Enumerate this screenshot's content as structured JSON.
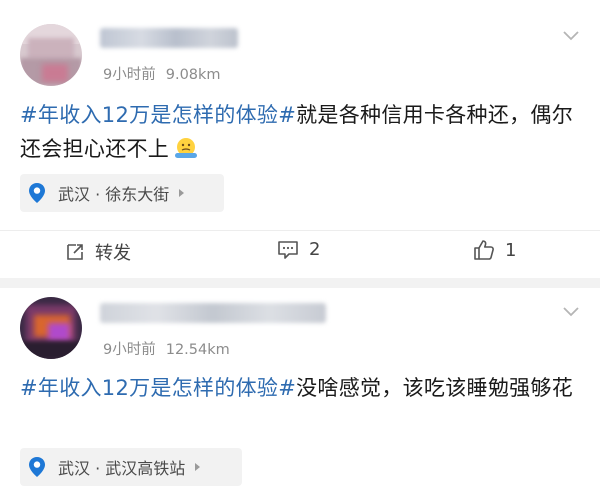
{
  "posts": [
    {
      "time": "9小时前",
      "distance": "9.08km",
      "topic": "#年收入12万是怎样的体验#",
      "text": "就是各种信用卡各种还，偶尔还会担心还不上",
      "location": "武汉 · 徐东大街",
      "actions": {
        "repost_label": "转发",
        "comment_count": "2",
        "like_count": "1"
      }
    },
    {
      "time": "9小时前",
      "distance": "12.54km",
      "topic": "#年收入12万是怎样的体验#",
      "text": "没啥感觉，该吃该睡勉强够花",
      "location": "武汉 · 武汉高铁站"
    }
  ],
  "colors": {
    "topic": "#2e6bb0",
    "location_pin": "#1e78d6",
    "meta_text": "#8c8c8c",
    "divider_band": "#f2f2f2"
  },
  "icons": [
    "chevron-down-icon",
    "map-pin-icon",
    "repost-icon",
    "comment-icon",
    "like-icon",
    "emoji-icon"
  ]
}
